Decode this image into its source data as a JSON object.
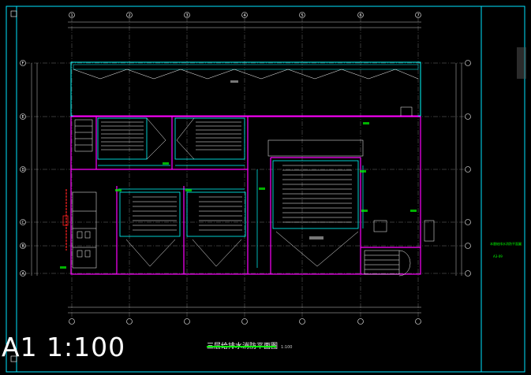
{
  "drawing": {
    "title": "三层给排水消防平面图",
    "title_scale": "1:100",
    "sheet_scale_note": "A1 1:100",
    "axes_top": [
      "1",
      "2",
      "3",
      "4",
      "5",
      "6",
      "7"
    ],
    "axes_left": [
      "F",
      "E",
      "D",
      "C",
      "B",
      "A"
    ],
    "side_notes": [
      "本層給排水消防平面圖",
      "A3-09"
    ],
    "colors": {
      "background": "#000000",
      "frame": "#00e5ff",
      "walls": "#ff00ff",
      "pipes": "#00ffff",
      "seats": "#ffffff",
      "fire_hydrant": "#ff2020",
      "title_line": "#00ff00"
    }
  }
}
